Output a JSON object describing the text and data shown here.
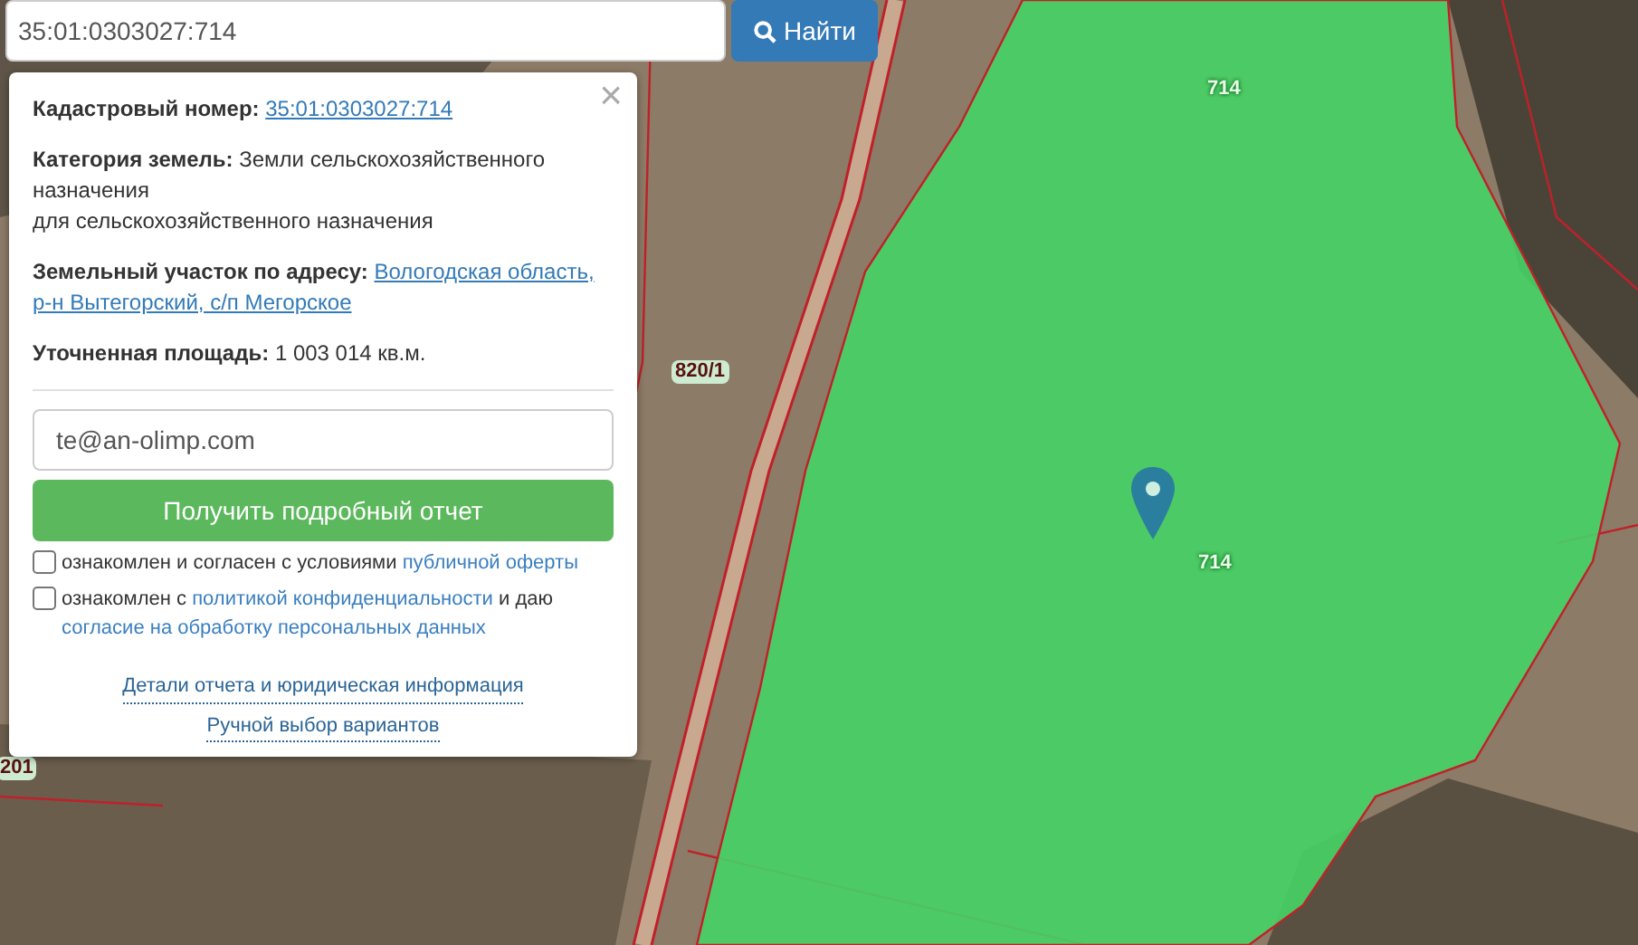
{
  "search": {
    "value": "35:01:0303027:714",
    "button": "Найти"
  },
  "info_panel": {
    "close": "×",
    "fields": [
      {
        "label": "Кадастровый номер:",
        "kind": "link",
        "lines": [
          "35:01:0303027:714"
        ]
      },
      {
        "label": "Категория земель:",
        "kind": "text",
        "lines": [
          "Земли сельскохозяйственного",
          "назначения",
          "для сельскохозяйственного назначения"
        ]
      },
      {
        "label": "Земельный участок по адресу:",
        "kind": "link",
        "lines": [
          "Вологодская область,",
          "р-н Вытегорский, с/п Мегорское"
        ]
      },
      {
        "label": "Уточненная площадь:",
        "kind": "text",
        "lines": [
          "1 003 014 кв.м."
        ]
      }
    ],
    "email": {
      "value": "te@an-olimp.com"
    },
    "submit": "Получить подробный отчет",
    "consents": [
      {
        "checked": false,
        "parts": [
          {
            "kind": "text",
            "text": "ознакомлен и согласен с условиями "
          },
          {
            "kind": "link",
            "text": "публичной оферты"
          }
        ]
      },
      {
        "checked": false,
        "parts": [
          {
            "kind": "text",
            "text": "ознакомлен с "
          },
          {
            "kind": "link",
            "text": "политикой конфиденциальности"
          },
          {
            "kind": "text",
            "text": " и даю "
          },
          {
            "kind": "link",
            "text": "согласие на обработку персональных данных"
          }
        ]
      }
    ],
    "links": [
      "Детали отчета и юридическая информация",
      "Ручной выбор вариантов"
    ]
  },
  "map": {
    "labels": [
      {
        "text": "714",
        "kind": "parcel"
      },
      {
        "text": "714",
        "kind": "parcel"
      },
      {
        "text": "820/1",
        "kind": "tag"
      },
      {
        "text": "201",
        "kind": "tag"
      }
    ]
  }
}
